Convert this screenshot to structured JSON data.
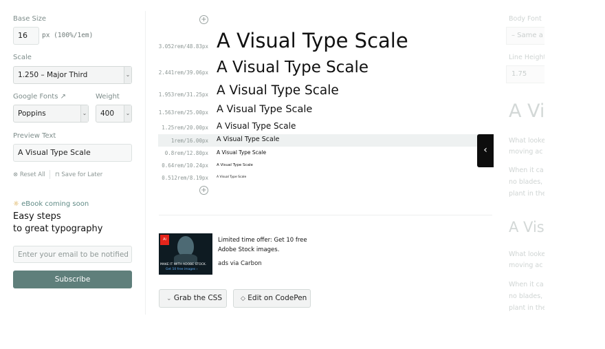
{
  "sidebar": {
    "base_size_label": "Base Size",
    "base_size_value": "16",
    "base_size_unit": "px (100%/1em)",
    "scale_label": "Scale",
    "scale_value": "1.250 – Major Third",
    "google_fonts_label": "Google Fonts",
    "weight_label": "Weight",
    "font_value": "Poppins",
    "weight_value": "400",
    "preview_text_label": "Preview Text",
    "preview_text_value": "A Visual Type Scale",
    "reset_all": "Reset All",
    "save_for_later": "Save for Later",
    "ebook_label": "eBook coming soon",
    "ebook_title_line1": "Easy steps",
    "ebook_title_line2": "to great typography",
    "email_placeholder": "Enter your email to be notified",
    "subscribe": "Subscribe"
  },
  "scale": {
    "rows": [
      {
        "measure": "3.052rem/48.83px",
        "text": "A Visual Type Scale"
      },
      {
        "measure": "2.441rem/39.06px",
        "text": "A Visual Type Scale"
      },
      {
        "measure": "1.953rem/31.25px",
        "text": "A Visual Type Scale"
      },
      {
        "measure": "1.563rem/25.00px",
        "text": "A Visual Type Scale"
      },
      {
        "measure": "1.25rem/20.00px",
        "text": "A Visual Type Scale"
      },
      {
        "measure": "1rem/16.00px",
        "text": "A Visual Type Scale"
      },
      {
        "measure": "0.8rem/12.80px",
        "text": "A Visual Type Scale"
      },
      {
        "measure": "0.64rem/10.24px",
        "text": "A Visual Type Scale"
      },
      {
        "measure": "0.512rem/8.19px",
        "text": "A Visual Type Scale"
      }
    ],
    "active_index": 5
  },
  "ad": {
    "line1": "Limited time offer: Get 10 free",
    "line2": "Adobe Stock images.",
    "via": "ads via Carbon",
    "image_text_1": "MAKE IT WITH ADOBE STOCK.",
    "image_text_2": "Get 10 free images ›",
    "logo_text": "Adobe"
  },
  "actions": {
    "grab_css": "Grab the CSS",
    "edit_codepen": "Edit on CodePen"
  },
  "panel": {
    "body_font_label": "Body Font",
    "body_font_value": "– Same a",
    "line_height_label": "Line Height",
    "line_height_value": "1.75",
    "heading_1": "A Vi",
    "para_1a": "What looke",
    "para_1b": "moving ac",
    "para_2a": "When it ca",
    "para_2b": "no blades,",
    "para_2c": "plant in the",
    "heading_2": "A Vis",
    "para_3a": "What looke",
    "para_3b": "moving ac",
    "para_4a": "When it ca",
    "para_4b": "no blades,",
    "para_4c": "plant in the"
  }
}
